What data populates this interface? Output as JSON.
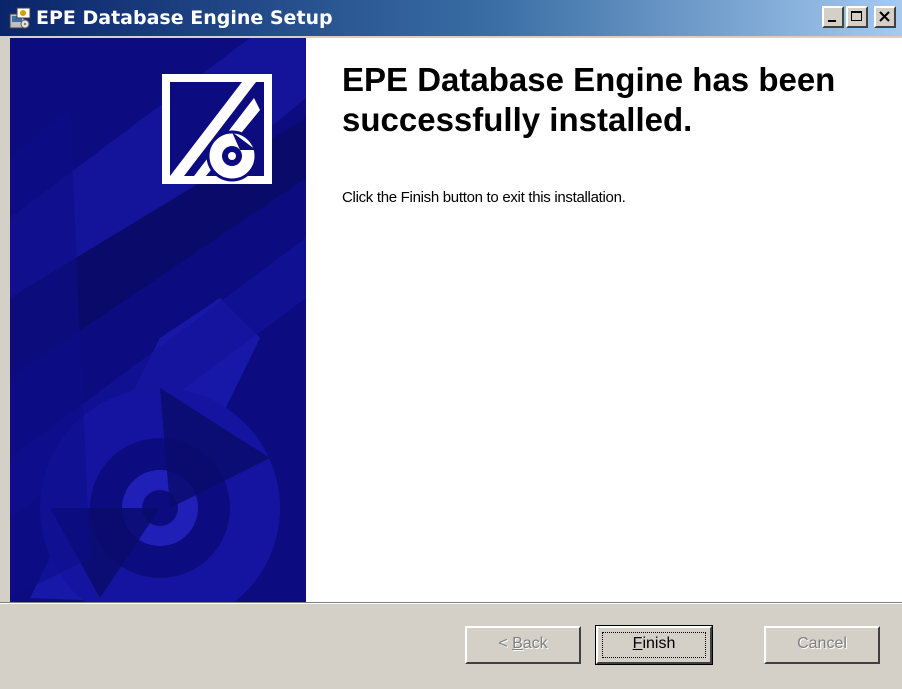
{
  "window": {
    "title": "EPE Database Engine Setup",
    "controls": [
      "minimize",
      "maximize",
      "close"
    ]
  },
  "content": {
    "heading": "EPE Database Engine has been successfully installed.",
    "description": "Click the Finish button to exit this installation."
  },
  "buttons": {
    "back": {
      "mnemonic": "B",
      "rest": "ack",
      "prefix": "< ",
      "enabled": false
    },
    "finish": {
      "mnemonic": "F",
      "rest": "inish",
      "enabled": true,
      "default": true
    },
    "cancel": {
      "label": "Cancel",
      "enabled": false
    }
  },
  "colors": {
    "titlebar_start": "#0a246a",
    "titlebar_end": "#a6caf0",
    "side_panel": "#0c0c80",
    "dialog_bg": "#d4d0c8"
  }
}
